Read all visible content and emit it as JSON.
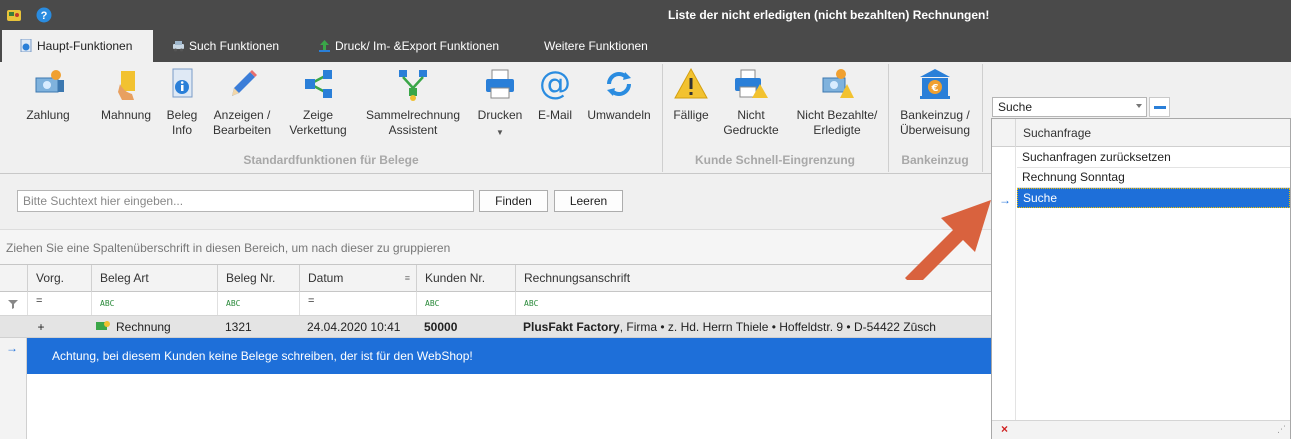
{
  "window": {
    "title": "Liste der nicht erledigten (nicht bezahlten) Rechnungen!",
    "icons": [
      "app-icon",
      "help-icon"
    ]
  },
  "tabs": [
    {
      "label": "Haupt-Funktionen",
      "active": true,
      "icon": "info-icon"
    },
    {
      "label": "Such Funktionen",
      "active": false,
      "icon": "search-car-icon"
    },
    {
      "label": "Druck/ Im- &Export Funktionen",
      "active": false,
      "icon": "upload-arrow-icon"
    },
    {
      "label": "Weitere Funktionen",
      "active": false
    }
  ],
  "ribbon": {
    "groups": [
      {
        "label": "Standardfunktionen für Belege"
      },
      {
        "label": "Kunde Schnell-Eingrenzung"
      },
      {
        "label": "Bankeinzug"
      }
    ],
    "buttons": [
      {
        "label": "Zahlung",
        "icon": "money-icon"
      },
      {
        "label": "Mahnung",
        "icon": "warning-hand-icon"
      },
      {
        "label": "Beleg\nInfo",
        "line1": "Beleg",
        "line2": "Info",
        "icon": "info-document-icon"
      },
      {
        "label": "Anzeigen / Bearbeiten",
        "line1": "Anzeigen /",
        "line2": "Bearbeiten",
        "icon": "pencil-icon"
      },
      {
        "label": "Zeige Verkettung",
        "line1": "Zeige",
        "line2": "Verkettung",
        "icon": "share-chain-icon"
      },
      {
        "label": "Sammelrechnung Assistent",
        "line1": "Sammelrechnung",
        "line2": "Assistent",
        "icon": "merge-icon"
      },
      {
        "label": "Drucken",
        "icon": "printer-icon"
      },
      {
        "label": "E-Mail",
        "icon": "at-icon"
      },
      {
        "label": "Umwandeln",
        "icon": "convert-icon"
      },
      {
        "label": "Fällige",
        "icon": "warning-triangle-icon"
      },
      {
        "label": "Nicht Gedruckte",
        "line1": "Nicht",
        "line2": "Gedruckte",
        "icon": "printer-warning-icon"
      },
      {
        "label": "Nicht Bezahlte/ Erledigte",
        "line1": "Nicht Bezahlte/",
        "line2": "Erledigte",
        "icon": "money-warning-icon"
      },
      {
        "label": "Bankeinzug / Überweisung",
        "line1": "Bankeinzug /",
        "line2": "Überweisung",
        "icon": "bank-icon"
      }
    ]
  },
  "search": {
    "placeholder": "Bitte Suchtext hier eingeben...",
    "find_label": "Finden",
    "clear_label": "Leeren"
  },
  "group_hint": "Ziehen Sie eine Spaltenüberschrift in diesen Bereich, um nach dieser zu gruppieren",
  "grid": {
    "columns": [
      "Vorg.",
      "Beleg Art",
      "Beleg Nr.",
      "Datum",
      "Kunden Nr.",
      "Rechnungsanschrift"
    ],
    "row": {
      "expand": "+",
      "beleg_art": "Rechnung",
      "beleg_nr": "1321",
      "datum": "24.04.2020 10:41",
      "kunden_nr": "50000",
      "anschrift_bold": "PlusFakt Factory",
      "anschrift_rest": ", Firma • z. Hd. Herrn Thiele • Hoffeldstr. 9 • D-54422 Zūsch"
    },
    "warning": "Achtung, bei diesem Kunden keine Belege schreiben, der ist für den WebShop!",
    "filter_marks": {
      "eq": "=",
      "abc": "ABC"
    }
  },
  "query_combo": {
    "value": "Suche",
    "header": "Suchanfrage",
    "items": [
      "Suchanfragen zurücksetzen",
      "Rechnung Sonntag",
      "Suche"
    ],
    "selected_index": 2,
    "footer_close": "×",
    "footer_grip": "⋰"
  },
  "colors": {
    "titlebar": "#4a4a4a",
    "selection": "#1e6fd9",
    "arrow": "#d9623e"
  }
}
